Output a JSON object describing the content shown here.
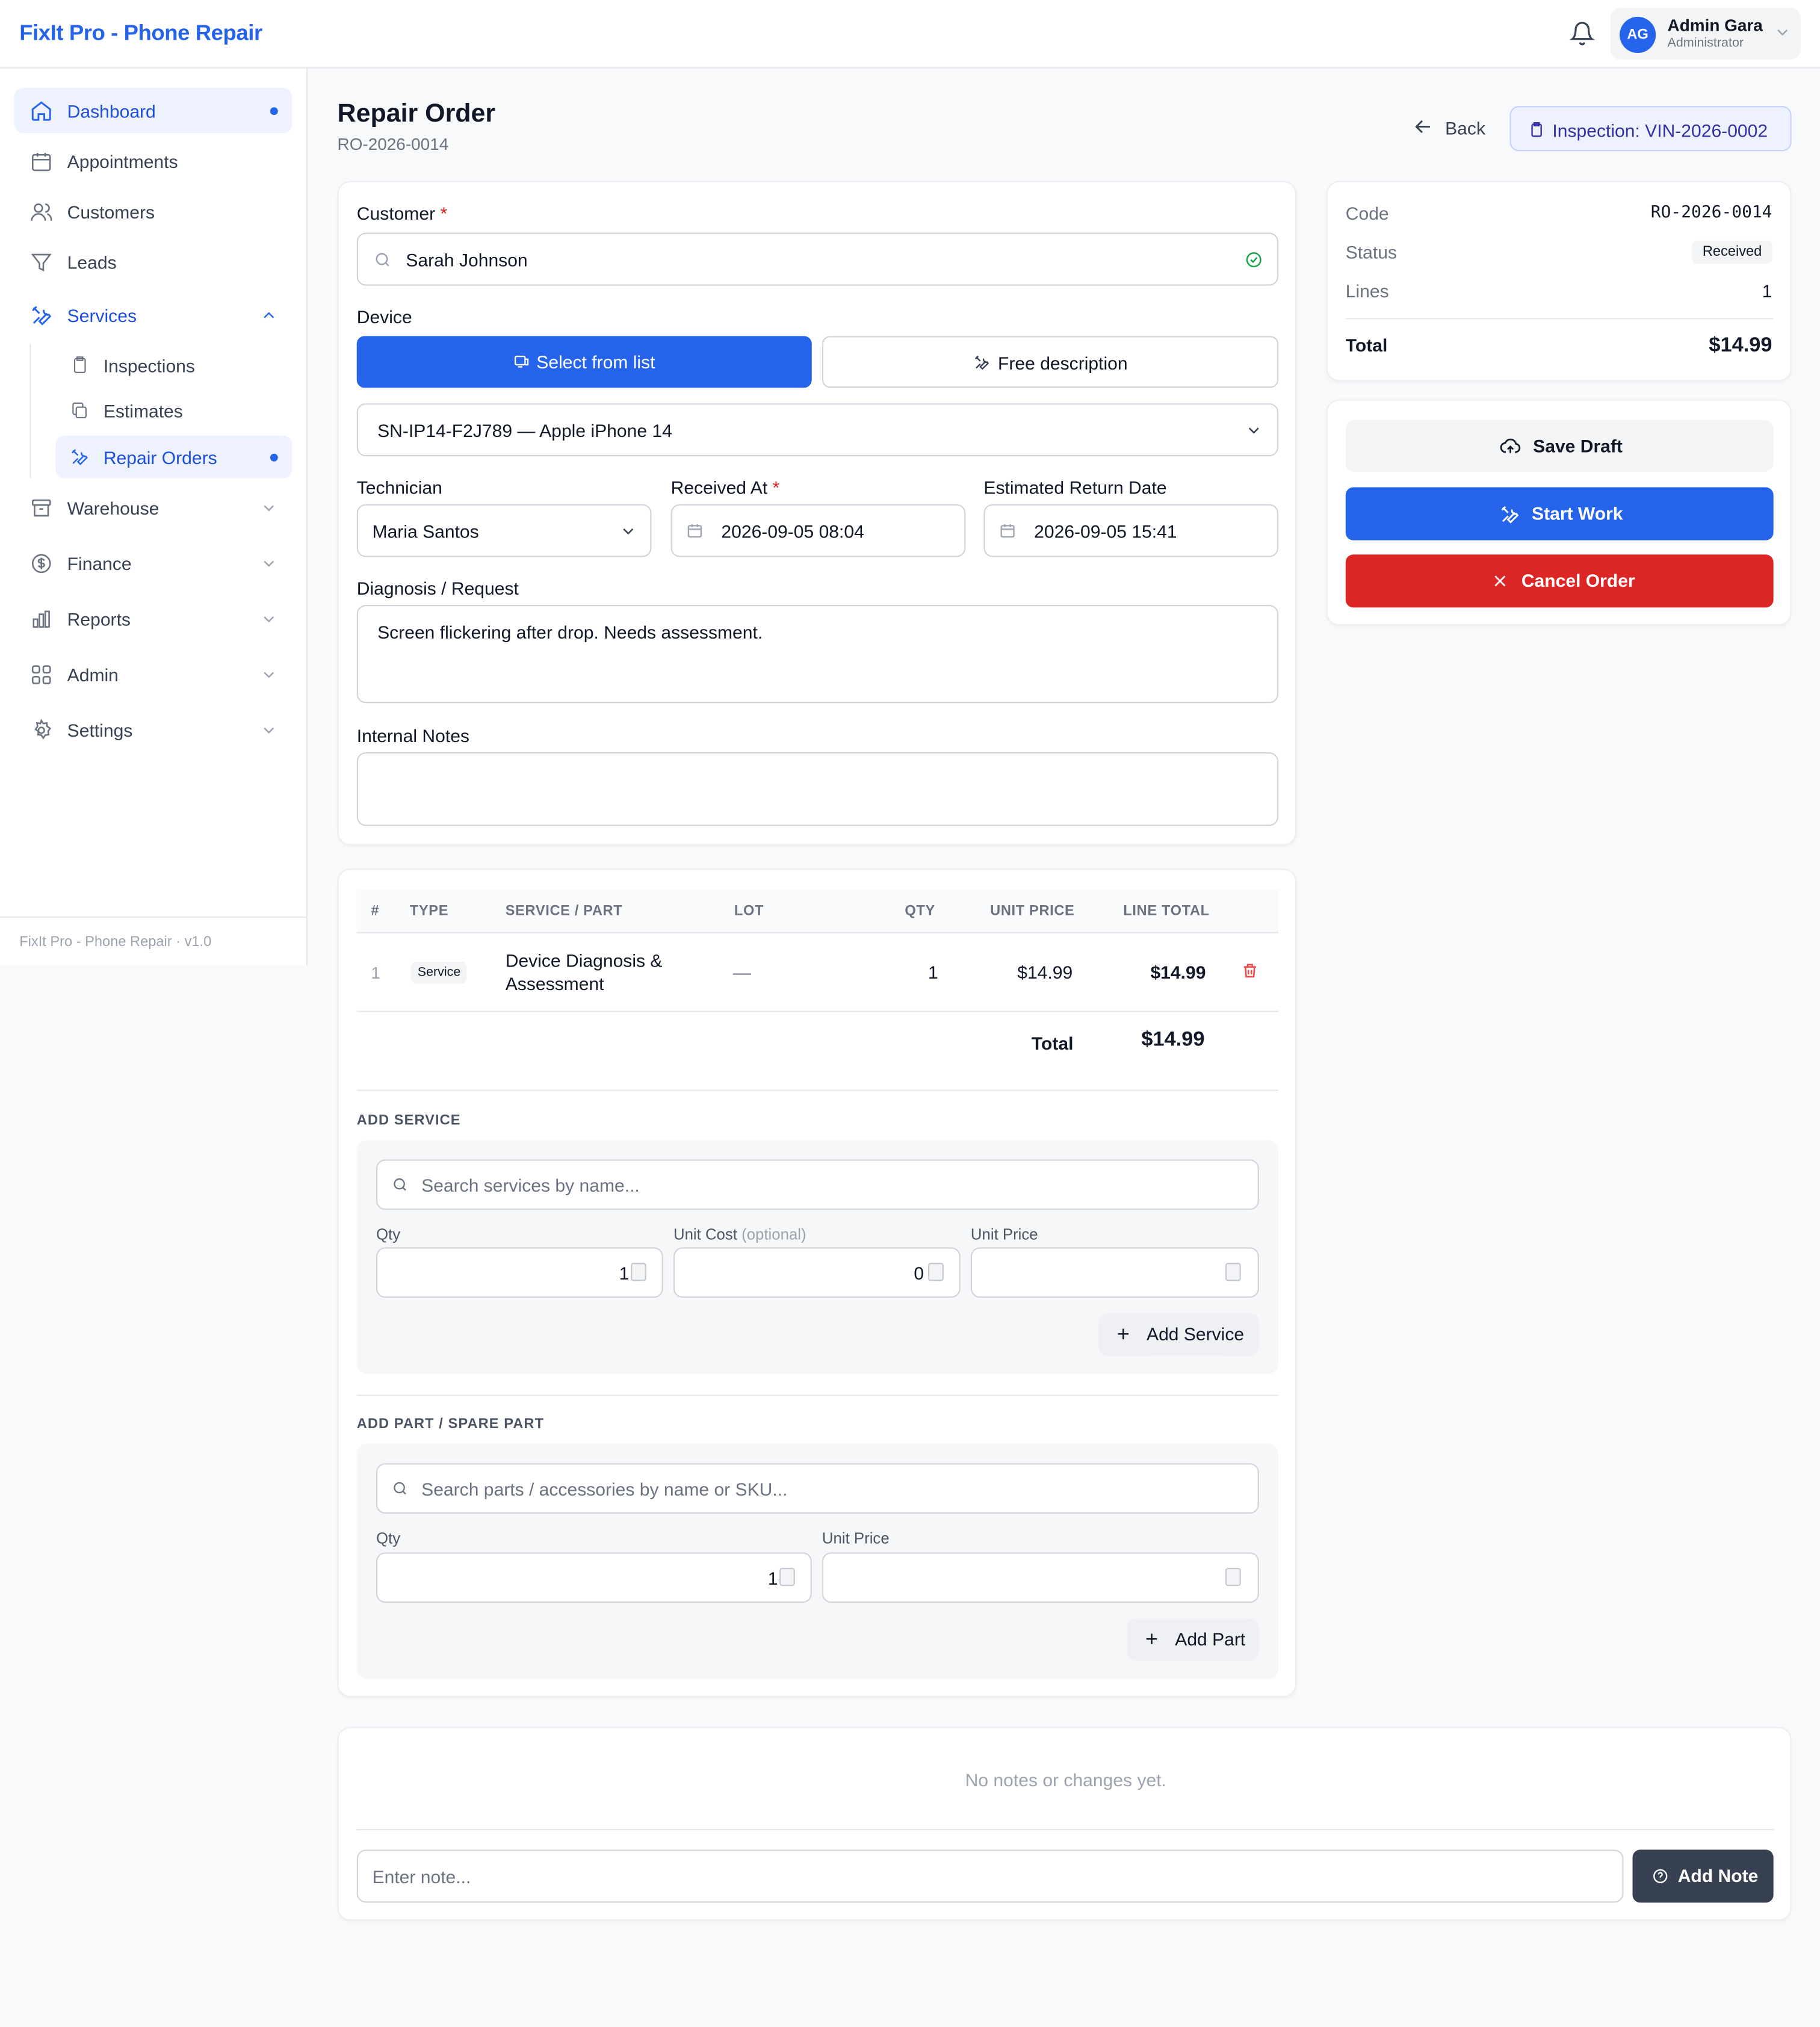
{
  "app": {
    "brand": "FixIt Pro - Phone Repair"
  },
  "user": {
    "initials": "AG",
    "name": "Admin Gara",
    "role": "Administrator"
  },
  "sidebar": {
    "items": [
      {
        "label": "Dashboard"
      },
      {
        "label": "Appointments"
      },
      {
        "label": "Customers"
      },
      {
        "label": "Leads"
      },
      {
        "label": "Services"
      },
      {
        "label": "Warehouse"
      },
      {
        "label": "Finance"
      },
      {
        "label": "Reports"
      },
      {
        "label": "Admin"
      },
      {
        "label": "Settings"
      }
    ],
    "services_sub": [
      {
        "label": "Inspections"
      },
      {
        "label": "Estimates"
      },
      {
        "label": "Repair Orders"
      }
    ],
    "footer": "FixIt Pro - Phone Repair · v1.0"
  },
  "page": {
    "title": "Repair Order",
    "code": "RO-2026-0014",
    "back_label": "Back",
    "inspection_label": "Inspection: VIN-2026-0002"
  },
  "form": {
    "customer_label": "Customer",
    "customer_value": "Sarah Johnson",
    "device_label": "Device",
    "select_from_list": "Select from list",
    "free_description": "Free description",
    "device_value": "SN-IP14-F2J789 — Apple iPhone 14",
    "technician_label": "Technician",
    "technician_value": "Maria Santos",
    "received_label": "Received At",
    "received_value": "2026-09-05 08:04",
    "return_label": "Estimated Return Date",
    "return_value": "2026-09-05 15:41",
    "diagnosis_label": "Diagnosis / Request",
    "diagnosis_value": "Screen flickering after drop. Needs assessment.",
    "notes_label": "Internal Notes",
    "req_mark": "*"
  },
  "lines": {
    "headers": [
      "#",
      "TYPE",
      "SERVICE / PART",
      "LOT",
      "QTY",
      "UNIT PRICE",
      "LINE TOTAL"
    ],
    "rows": [
      {
        "num": "1",
        "type": "Service",
        "name1": "Device Diagnosis &",
        "name2": "Assessment",
        "lot": "—",
        "qty": "1",
        "unit": "$14.99",
        "total": "$14.99"
      }
    ],
    "total_label": "Total",
    "total_value": "$14.99"
  },
  "add_service": {
    "title": "ADD SERVICE",
    "search_placeholder": "Search services by name...",
    "qty_label": "Qty",
    "qty_value": "1",
    "cost_label": "Unit Cost",
    "cost_optional": "(optional)",
    "cost_value": "0",
    "price_label": "Unit Price",
    "button": "Add Service"
  },
  "add_part": {
    "title": "ADD PART / SPARE PART",
    "search_placeholder": "Search parts / accessories by name or SKU...",
    "qty_label": "Qty",
    "qty_value": "1",
    "price_label": "Unit Price",
    "button": "Add Part"
  },
  "summary": {
    "code_label": "Code",
    "code_value": "RO-2026-0014",
    "status_label": "Status",
    "status_value": "Received",
    "lines_label": "Lines",
    "lines_value": "1",
    "total_label": "Total",
    "total_value": "$14.99"
  },
  "actions": {
    "save": "Save Draft",
    "start": "Start Work",
    "cancel": "Cancel Order"
  },
  "notes": {
    "empty": "No notes or changes yet.",
    "placeholder": "Enter note...",
    "button": "Add Note"
  },
  "colors": {
    "primary": "#2563eb",
    "danger": "#dc2626",
    "dark": "#374151"
  }
}
